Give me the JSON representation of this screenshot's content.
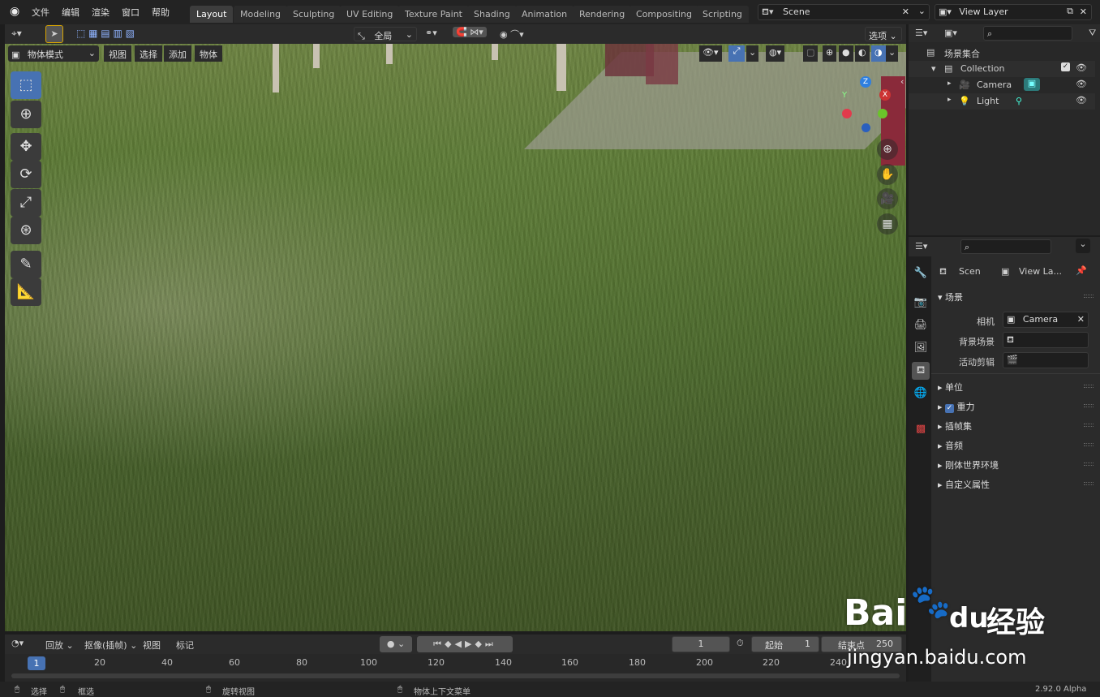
{
  "menu": [
    "文件",
    "编辑",
    "渲染",
    "窗口",
    "帮助"
  ],
  "workspaces": [
    "Layout",
    "Modeling",
    "Sculpting",
    "UV Editing",
    "Texture Paint",
    "Shading",
    "Animation",
    "Rendering",
    "Compositing",
    "Scripting"
  ],
  "scene": {
    "value": "Scene"
  },
  "view_layer": {
    "value": "View Layer"
  },
  "vp_toolbar": {
    "transform": "全局",
    "options": "选项"
  },
  "vp_header": {
    "mode": "物体模式",
    "view": "视图",
    "select": "选择",
    "add": "添加",
    "object": "物体"
  },
  "gizmo": {
    "z": "Z",
    "y": "Y",
    "x": "X"
  },
  "outliner": {
    "root": "场景集合",
    "collection": "Collection",
    "camera": "Camera",
    "light": "Light"
  },
  "props": {
    "scene_label": "Scen",
    "viewlayer_label": "View La...",
    "panel_title": "场景",
    "camera_label": "相机",
    "camera_value": "Camera",
    "bg_label": "背景场景",
    "clip_label": "活动剪辑",
    "sections": [
      "单位",
      "重力",
      "插帧集",
      "音频",
      "刚体世界环境",
      "自定义属性"
    ]
  },
  "timeline": {
    "playback": "回放",
    "keying": "抠像(插帧)",
    "view": "视图",
    "marker": "标记",
    "current": "1",
    "start_label": "起始",
    "start": "1",
    "end_label": "结束点",
    "end": "250",
    "ticks": [
      "20",
      "40",
      "60",
      "80",
      "100",
      "120",
      "140",
      "160",
      "180",
      "200",
      "220",
      "240"
    ],
    "frame_marker": "1"
  },
  "status": {
    "select": "选择",
    "box": "框选",
    "rotate": "旋转视图",
    "context": "物体上下文菜单",
    "version": "2.92.0 Alpha"
  },
  "watermark": {
    "brand": "Bai",
    "brand2": "du",
    "cn": "经验",
    "url": "jingyan.baidu.com"
  },
  "colors": {
    "accent": "#4772b3",
    "active_ws": "#3d3d3d"
  }
}
